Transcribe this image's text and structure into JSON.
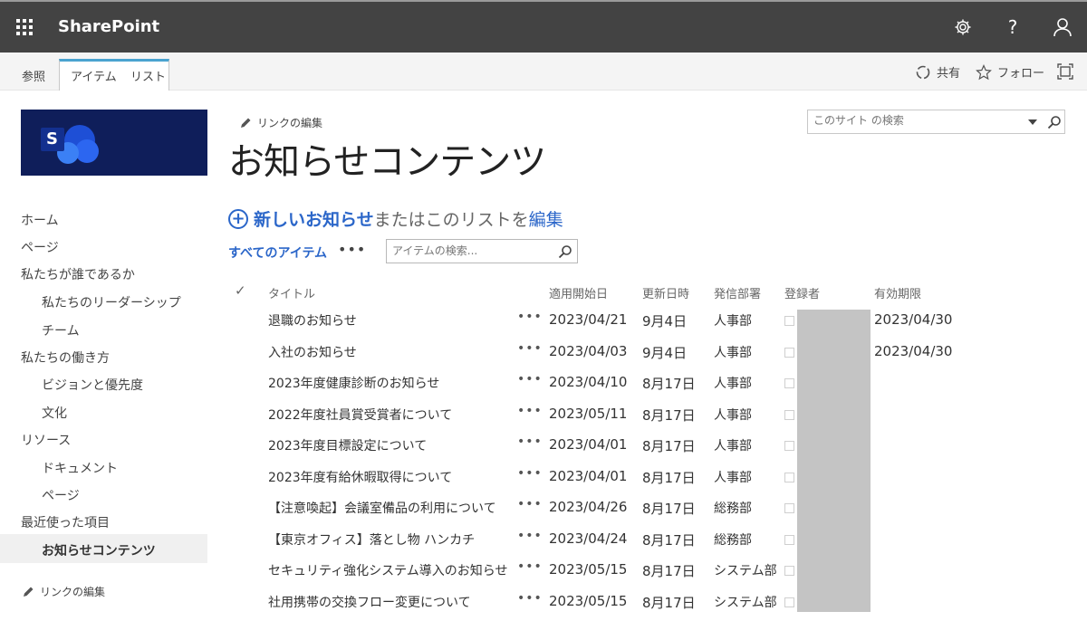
{
  "suitebar": {
    "brand": "SharePoint",
    "icons": [
      "waffle-icon",
      "gear-icon",
      "help-icon",
      "user-icon"
    ],
    "help_glyph": "?"
  },
  "ribbon": {
    "tabs": [
      "参照",
      "アイテム",
      "リスト"
    ],
    "share_label": "共有",
    "follow_label": "フォロー"
  },
  "sidenav": {
    "logo_letter": "S",
    "items": [
      {
        "label": "ホーム",
        "level": 0
      },
      {
        "label": "ページ",
        "level": 0
      },
      {
        "label": "私たちが誰であるか",
        "level": 0
      },
      {
        "label": "私たちのリーダーシップ",
        "level": 1
      },
      {
        "label": "チーム",
        "level": 1
      },
      {
        "label": "私たちの働き方",
        "level": 0
      },
      {
        "label": "ビジョンと優先度",
        "level": 1
      },
      {
        "label": "文化",
        "level": 1
      },
      {
        "label": "リソース",
        "level": 0
      },
      {
        "label": "ドキュメント",
        "level": 1
      },
      {
        "label": "ページ",
        "level": 1
      },
      {
        "label": "最近使った項目",
        "level": 0
      }
    ],
    "selected": "お知らせコンテンツ",
    "edit_links": "リンクの編集"
  },
  "header": {
    "edit_links": "リンクの編集",
    "page_title": "お知らせコンテンツ",
    "site_search_placeholder": "このサイト の検索"
  },
  "toolbar": {
    "new_label": "新しいお知らせ",
    "or_text": "またはこのリストを",
    "edit_label": "編集",
    "view_all": "すべてのアイテム",
    "more": "•••",
    "item_search_placeholder": "アイテムの検索..."
  },
  "table": {
    "columns": {
      "check": "✓",
      "title": "タイトル",
      "start": "適用開始日",
      "modified": "更新日時",
      "dept": "発信部署",
      "registrant": "登録者",
      "expiry": "有効期限"
    },
    "ellipsis": "•••",
    "rows": [
      {
        "title": "退職のお知らせ",
        "start": "2023/04/21",
        "modified": "9月4日",
        "dept": "人事部",
        "expiry": "2023/04/30"
      },
      {
        "title": "入社のお知らせ",
        "start": "2023/04/03",
        "modified": "9月4日",
        "dept": "人事部",
        "expiry": "2023/04/30"
      },
      {
        "title": "2023年度健康診断のお知らせ",
        "start": "2023/04/10",
        "modified": "8月17日",
        "dept": "人事部",
        "expiry": ""
      },
      {
        "title": "2022年度社員賞受賞者について",
        "start": "2023/05/11",
        "modified": "8月17日",
        "dept": "人事部",
        "expiry": ""
      },
      {
        "title": "2023年度目標設定について",
        "start": "2023/04/01",
        "modified": "8月17日",
        "dept": "人事部",
        "expiry": ""
      },
      {
        "title": "2023年度有給休暇取得について",
        "start": "2023/04/01",
        "modified": "8月17日",
        "dept": "人事部",
        "expiry": ""
      },
      {
        "title": "【注意喚起】会議室備品の利用について",
        "start": "2023/04/26",
        "modified": "8月17日",
        "dept": "総務部",
        "expiry": ""
      },
      {
        "title": "【東京オフィス】落とし物 ハンカチ",
        "start": "2023/04/24",
        "modified": "8月17日",
        "dept": "総務部",
        "expiry": ""
      },
      {
        "title": "セキュリティ強化システム導入のお知らせ",
        "start": "2023/05/15",
        "modified": "8月17日",
        "dept": "システム部",
        "expiry": ""
      },
      {
        "title": "社用携帯の交換フロー変更について",
        "start": "2023/05/15",
        "modified": "8月17日",
        "dept": "システム部",
        "expiry": ""
      }
    ]
  },
  "colors": {
    "suitebar_bg": "#434343",
    "accent": "#2b66c9",
    "logo_bg": "#0f1e5a"
  }
}
